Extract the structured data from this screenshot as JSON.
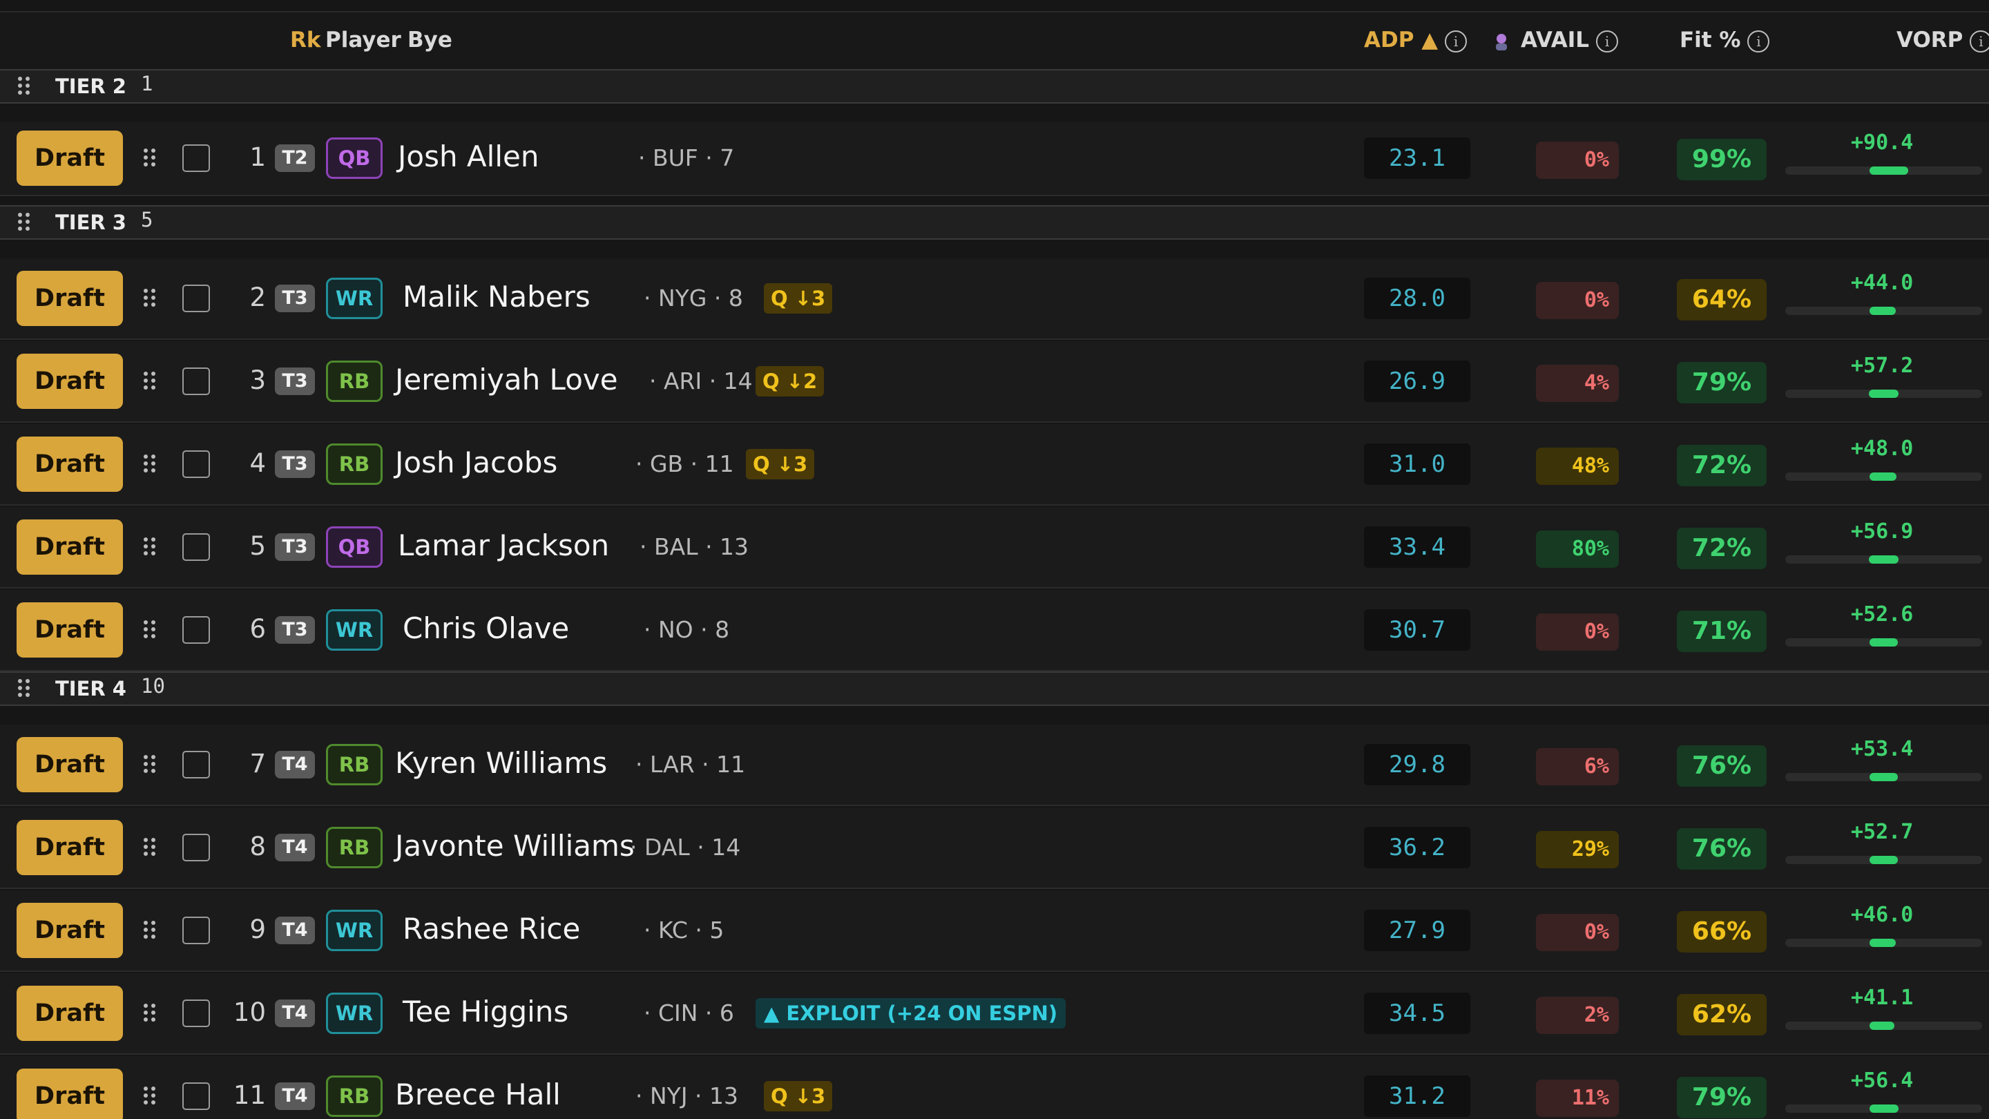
{
  "header": {
    "rk": "Rk",
    "player": "Player",
    "bye": "Bye",
    "adp": "ADP ▲",
    "avail": "AVAIL",
    "fit": "Fit %",
    "vorp": "VORP",
    "info_glyph": "i"
  },
  "draft_label": "Draft",
  "colors": {
    "accent": "#d9a63c",
    "good": "#3fd26f",
    "warn": "#f0c21c",
    "bad": "#ef6f6f",
    "adp": "#44b4c8"
  },
  "tiers": [
    {
      "label": "TIER 2",
      "count": "1",
      "players": [
        {
          "rank": "1",
          "tier": "T2",
          "pos": "QB",
          "name": "Josh Allen",
          "meta": "· BUF · 7",
          "badge": "",
          "adp": "23.1",
          "avail": "0%",
          "avail_level": "red",
          "fit": "99%",
          "fit_level": "grn",
          "vorp": "+90.4",
          "vorp_bar": 0.9
        }
      ]
    },
    {
      "label": "TIER 3",
      "count": "5",
      "players": [
        {
          "rank": "2",
          "tier": "T3",
          "pos": "WR",
          "name": "Malik Nabers",
          "meta": "· NYG · 8",
          "badge": "Q ↓3",
          "adp": "28.0",
          "avail": "0%",
          "avail_level": "red",
          "fit": "64%",
          "fit_level": "yel",
          "vorp": "+44.0",
          "vorp_bar": 0.44
        },
        {
          "rank": "3",
          "tier": "T3",
          "pos": "RB",
          "name": "Jeremiyah Love",
          "meta": "· ARI · 14",
          "badge": "Q ↓2",
          "adp": "26.9",
          "avail": "4%",
          "avail_level": "red",
          "fit": "79%",
          "fit_level": "grn",
          "vorp": "+57.2",
          "vorp_bar": 0.57
        },
        {
          "rank": "4",
          "tier": "T3",
          "pos": "RB",
          "name": "Josh Jacobs",
          "meta": "· GB · 11",
          "badge": "Q ↓3",
          "adp": "31.0",
          "avail": "48%",
          "avail_level": "yel",
          "fit": "72%",
          "fit_level": "grn",
          "vorp": "+48.0",
          "vorp_bar": 0.48
        },
        {
          "rank": "5",
          "tier": "T3",
          "pos": "QB",
          "name": "Lamar Jackson",
          "meta": "· BAL · 13",
          "badge": "",
          "adp": "33.4",
          "avail": "80%",
          "avail_level": "grn",
          "fit": "72%",
          "fit_level": "grn",
          "vorp": "+56.9",
          "vorp_bar": 0.57
        },
        {
          "rank": "6",
          "tier": "T3",
          "pos": "WR",
          "name": "Chris Olave",
          "meta": "· NO · 8",
          "badge": "",
          "adp": "30.7",
          "avail": "0%",
          "avail_level": "red",
          "fit": "71%",
          "fit_level": "grn",
          "vorp": "+52.6",
          "vorp_bar": 0.53
        }
      ]
    },
    {
      "label": "TIER 4",
      "count": "10",
      "players": [
        {
          "rank": "7",
          "tier": "T4",
          "pos": "RB",
          "name": "Kyren Williams",
          "meta": "· LAR · 11",
          "badge": "",
          "adp": "29.8",
          "avail": "6%",
          "avail_level": "red",
          "fit": "76%",
          "fit_level": "grn",
          "vorp": "+53.4",
          "vorp_bar": 0.53
        },
        {
          "rank": "8",
          "tier": "T4",
          "pos": "RB",
          "name": "Javonte Williams",
          "meta": "· DAL · 14",
          "badge": "",
          "adp": "36.2",
          "avail": "29%",
          "avail_level": "yel",
          "fit": "76%",
          "fit_level": "grn",
          "vorp": "+52.7",
          "vorp_bar": 0.53
        },
        {
          "rank": "9",
          "tier": "T4",
          "pos": "WR",
          "name": "Rashee Rice",
          "meta": "· KC · 5",
          "badge": "",
          "adp": "27.9",
          "avail": "0%",
          "avail_level": "red",
          "fit": "66%",
          "fit_level": "yel",
          "vorp": "+46.0",
          "vorp_bar": 0.46
        },
        {
          "rank": "10",
          "tier": "T4",
          "pos": "WR",
          "name": "Tee Higgins",
          "meta": "· CIN · 6",
          "badge": "",
          "exploit": "▲ EXPLOIT (+24 ON ESPN)",
          "adp": "34.5",
          "avail": "2%",
          "avail_level": "red",
          "fit": "62%",
          "fit_level": "yel",
          "vorp": "+41.1",
          "vorp_bar": 0.41
        },
        {
          "rank": "11",
          "tier": "T4",
          "pos": "RB",
          "name": "Breece Hall",
          "meta": "· NYJ · 13",
          "badge": "Q ↓3",
          "adp": "31.2",
          "avail": "11%",
          "avail_level": "red",
          "fit": "79%",
          "fit_level": "grn",
          "vorp": "+56.4",
          "vorp_bar": 0.56
        }
      ]
    }
  ]
}
